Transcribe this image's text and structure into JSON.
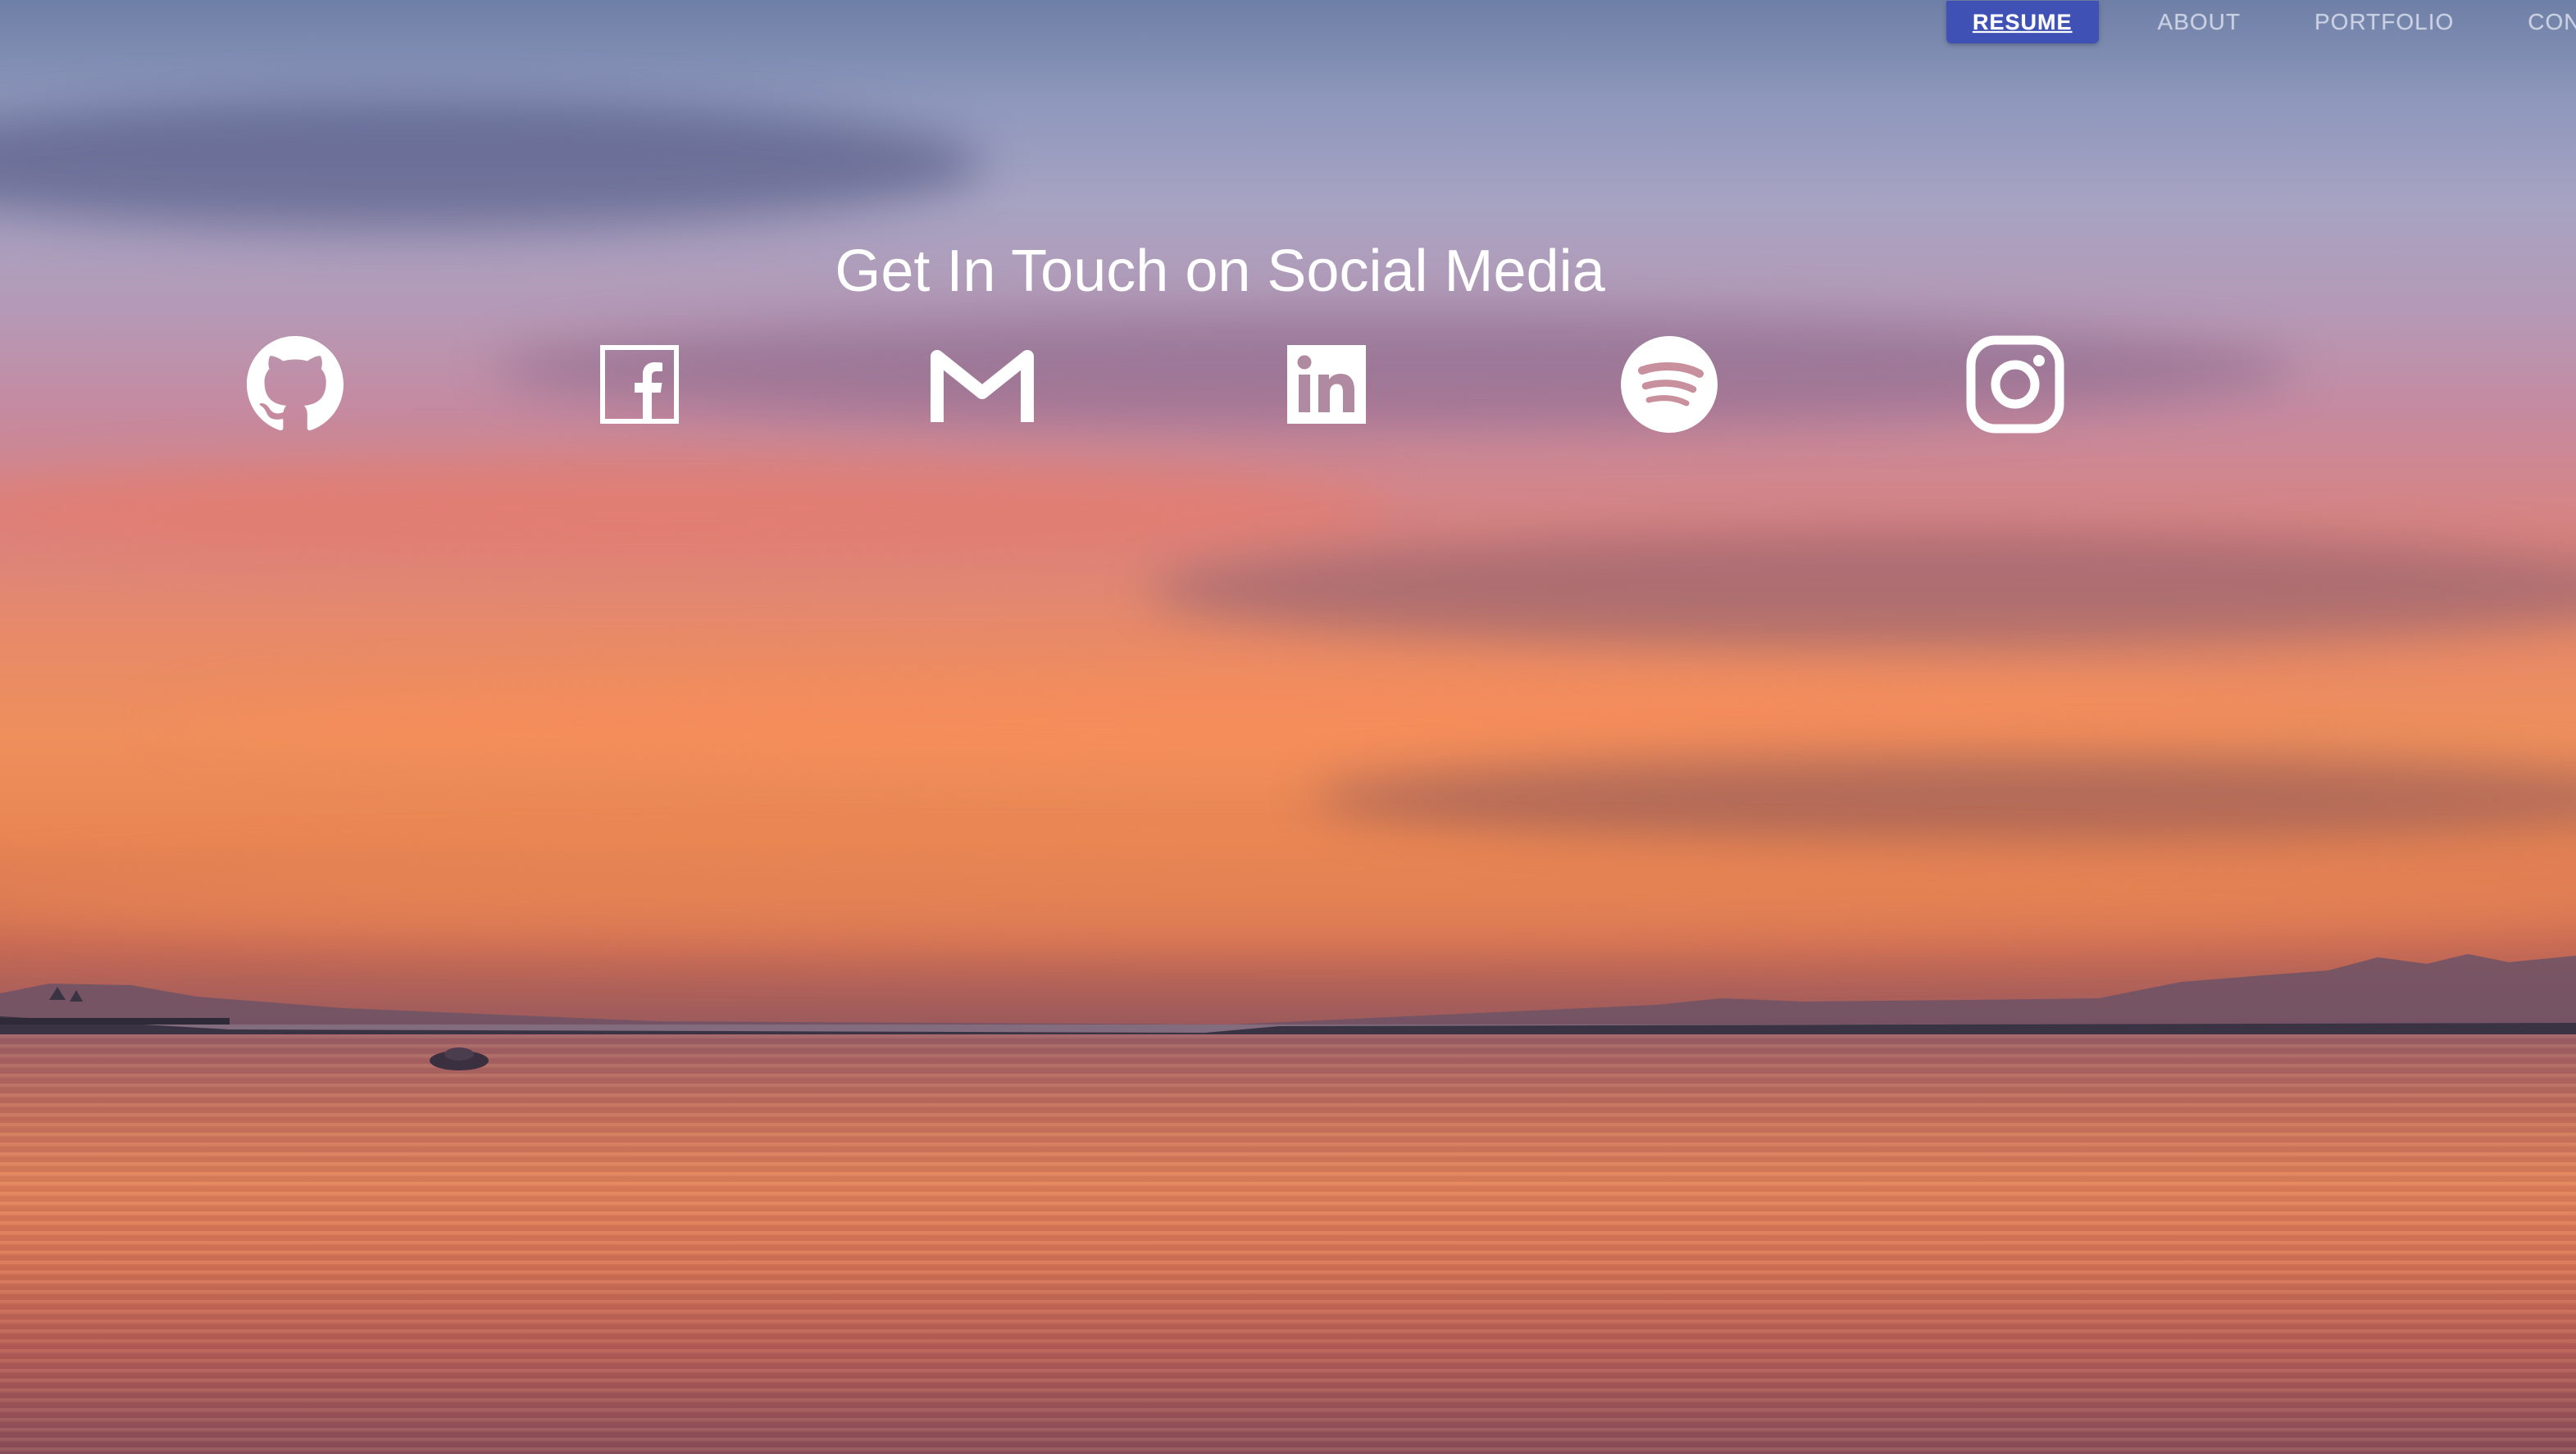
{
  "nav": {
    "items": [
      {
        "label": "RESUME",
        "active": true
      },
      {
        "label": "ABOUT",
        "active": false
      },
      {
        "label": "PORTFOLIO",
        "active": false
      },
      {
        "label": "CON",
        "active": false
      }
    ]
  },
  "contact": {
    "heading": "Get In Touch on Social Media",
    "socials": [
      {
        "icon": "github-icon"
      },
      {
        "icon": "facebook-icon"
      },
      {
        "icon": "gmail-icon"
      },
      {
        "icon": "linkedin-icon"
      },
      {
        "icon": "spotify-icon"
      },
      {
        "icon": "instagram-icon"
      }
    ]
  },
  "colors": {
    "accent": "#3f51b5",
    "icon": "#ffffff"
  }
}
